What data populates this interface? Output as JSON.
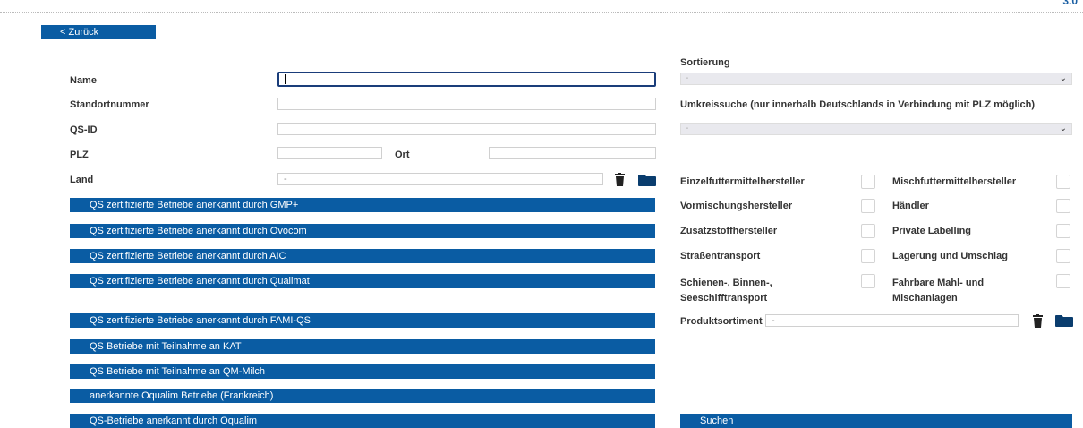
{
  "header": {
    "corner_text": "3.0",
    "back_label": "< Zurück"
  },
  "form": {
    "name_label": "Name",
    "name_value": "",
    "standort_label": "Standortnummer",
    "standort_value": "",
    "qsid_label": "QS-ID",
    "qsid_value": "",
    "plz_label": "PLZ",
    "plz_value": "",
    "ort_label": "Ort",
    "ort_value": "",
    "land_label": "Land",
    "land_value": "-"
  },
  "filters": [
    "QS zertifizierte Betriebe anerkannt durch GMP+",
    "QS zertifizierte Betriebe anerkannt durch Ovocom",
    "QS zertifizierte Betriebe anerkannt durch AIC",
    "QS zertifizierte Betriebe anerkannt durch Qualimat",
    "QS zertifizierte Betriebe anerkannt durch FAMI-QS",
    "QS Betriebe mit Teilnahme an KAT",
    "QS Betriebe mit Teilnahme an QM-Milch",
    "anerkannte Oqualim Betriebe (Frankreich)",
    "QS-Betriebe anerkannt durch Oqualim"
  ],
  "right": {
    "sort_label": "Sortierung",
    "sort_value": "-",
    "radius_label": "Umkreissuche (nur innerhalb Deutschlands in Verbindung mit PLZ möglich)",
    "radius_value": "-",
    "categories_left": [
      "Einzelfuttermittelhersteller",
      "Vormischungshersteller",
      "Zusatzstoffhersteller",
      "Straßentransport",
      "Schienen-, Binnen-, Seeschifftransport"
    ],
    "categories_right": [
      "Mischfuttermittelhersteller",
      "Händler",
      "Private Labelling",
      "Lagerung und Umschlag",
      "Fahrbare Mahl- und Mischanlagen"
    ],
    "product_label": "Produktsortiment",
    "product_value": "-",
    "search_label": "Suchen"
  },
  "colors": {
    "accent": "#0a5ca3",
    "focus_border": "#1a3d7a"
  }
}
